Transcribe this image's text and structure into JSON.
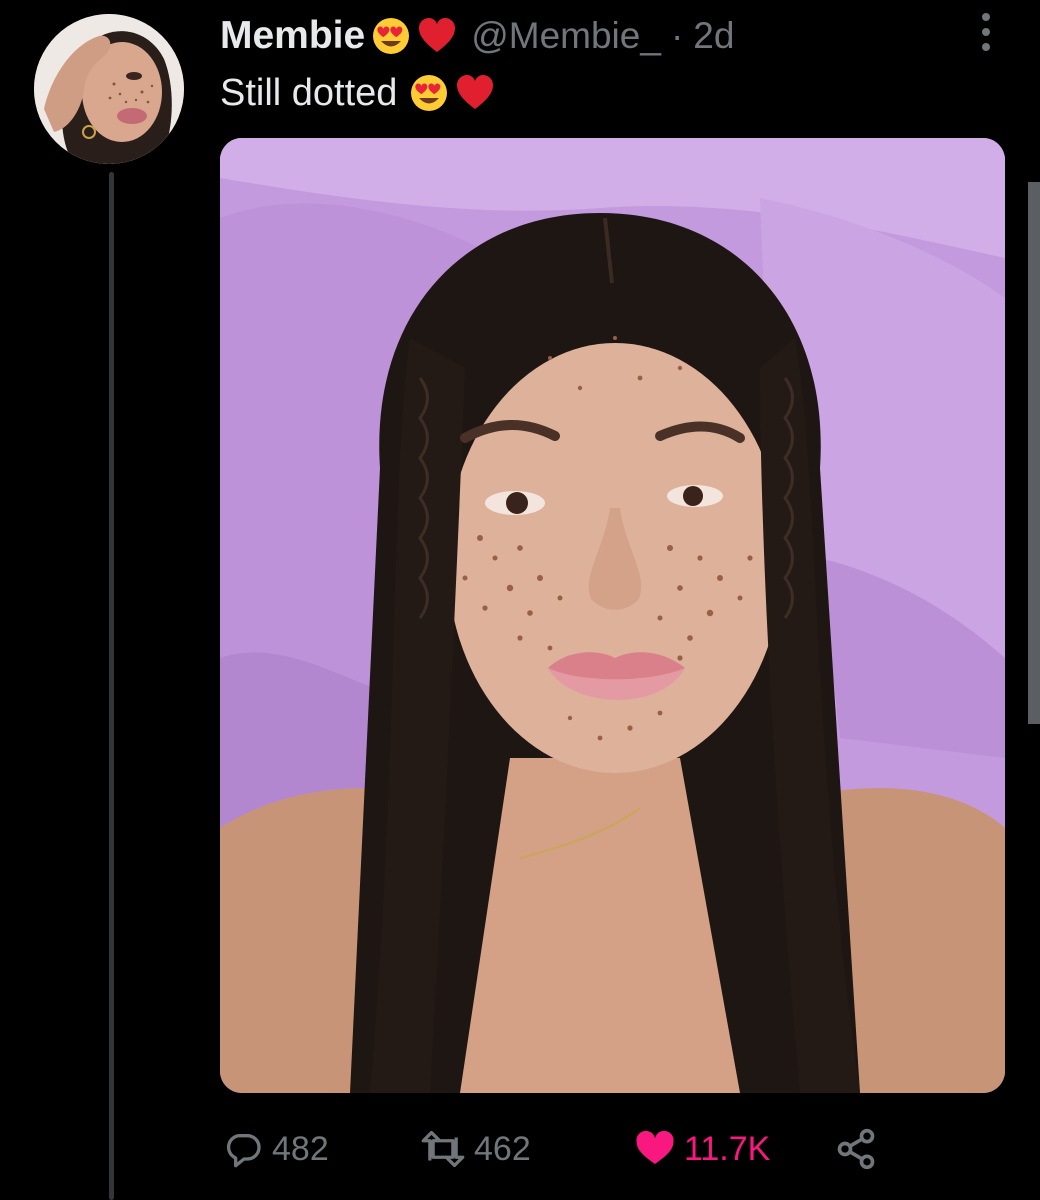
{
  "tweet": {
    "display_name": "Membie",
    "name_emojis": [
      "heart-eyes-emoji",
      "red-heart-emoji"
    ],
    "handle": "@Membie_",
    "separator": "·",
    "time": "2d",
    "text": "Still dotted",
    "text_emojis": [
      "heart-eyes-emoji",
      "red-heart-emoji"
    ],
    "photo_description_icon": "photo"
  },
  "actions": {
    "replies": "482",
    "retweets": "462",
    "likes": "11.7K",
    "reply_icon": "reply-icon",
    "retweet_icon": "retweet-icon",
    "like_icon": "heart-icon",
    "share_icon": "share-icon"
  },
  "colors": {
    "background": "#000000",
    "text": "#e7e9ea",
    "secondary": "#71767b",
    "like": "#f91880",
    "thread_line": "#333639",
    "photo_background": "#c49adc"
  }
}
